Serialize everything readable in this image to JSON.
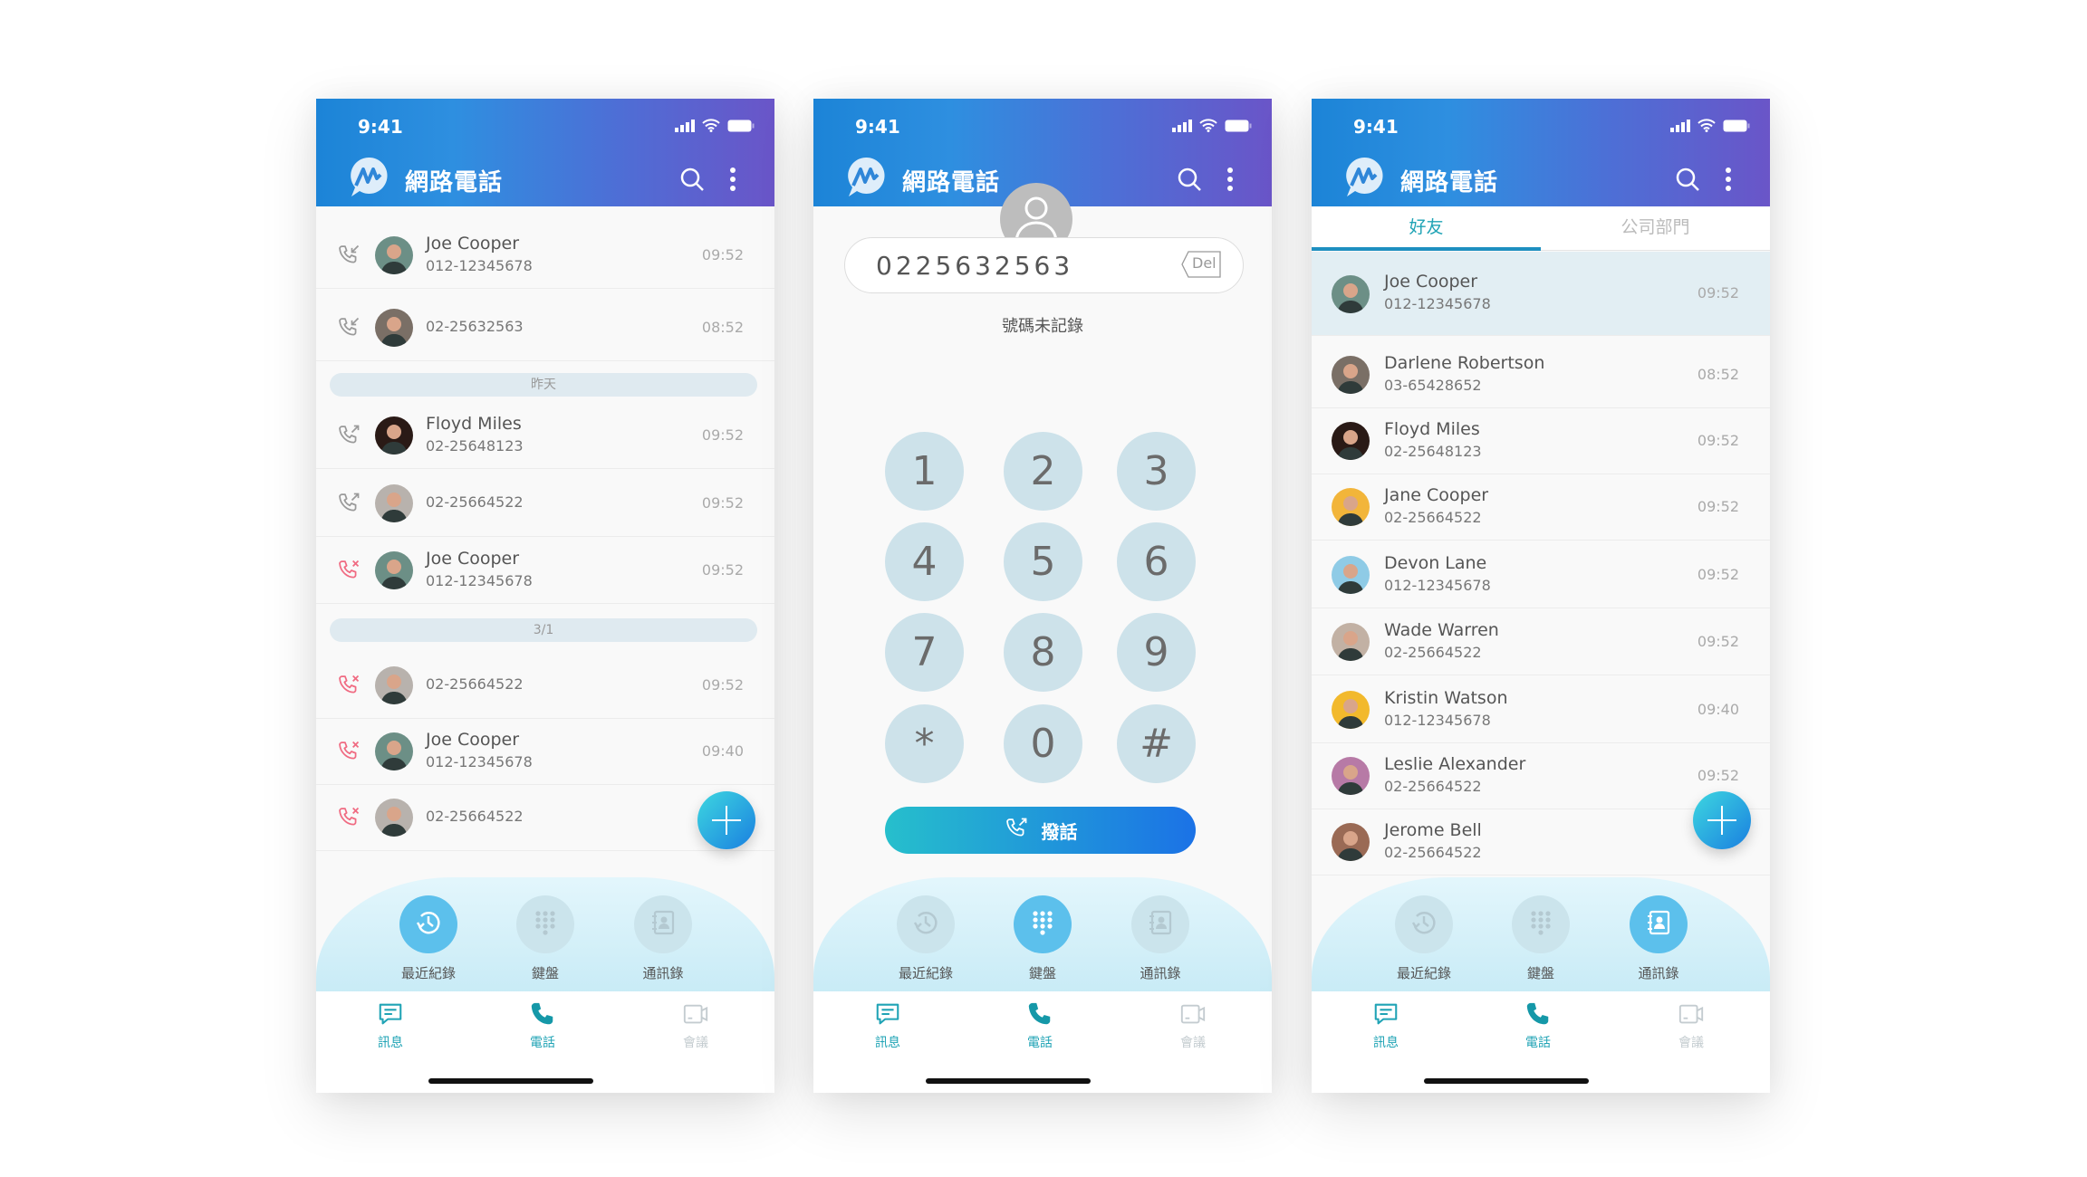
{
  "status_bar": {
    "time": "9:41"
  },
  "app": {
    "title": "網路電話"
  },
  "colors": {
    "missed": "#f06b82",
    "accent": "#1fa3b5",
    "header_start": "#1c84d7",
    "header_end": "#6a55c8"
  },
  "recents": {
    "entries": [
      {
        "type": "incoming",
        "name": "Joe Cooper",
        "number": "012-12345678",
        "time": "09:52",
        "avatar": "#6c8f86"
      },
      {
        "type": "incoming",
        "name": "",
        "number": "02-25632563",
        "time": "08:52",
        "avatar": "#7a6f66"
      },
      {
        "type": "divider",
        "label": "昨天"
      },
      {
        "type": "outgoing",
        "name": "Floyd Miles",
        "number": "02-25648123",
        "time": "09:52",
        "avatar": "#2a1a16"
      },
      {
        "type": "outgoing",
        "name": "",
        "number": "02-25664522",
        "time": "09:52",
        "avatar": "#b8b2ad"
      },
      {
        "type": "missed",
        "name": "Joe Cooper",
        "number": "012-12345678",
        "time": "09:52",
        "avatar": "#6c8f86"
      },
      {
        "type": "divider",
        "label": "3/1"
      },
      {
        "type": "missed",
        "name": "",
        "number": "02-25664522",
        "time": "09:52",
        "avatar": "#b8b2ad"
      },
      {
        "type": "missed",
        "name": "Joe Cooper",
        "number": "012-12345678",
        "time": "09:40",
        "avatar": "#6c8f86"
      },
      {
        "type": "missed",
        "name": "",
        "number": "02-25664522",
        "time": "",
        "avatar": "#b8b2ad"
      }
    ]
  },
  "dialer": {
    "unknown_label": "號碼未記錄",
    "input_value": "0225632563",
    "del_label": "Del",
    "keys": [
      "1",
      "2",
      "3",
      "4",
      "5",
      "6",
      "7",
      "8",
      "9",
      "*",
      "0",
      "#"
    ],
    "call_label": "撥話"
  },
  "contacts": {
    "tabs": [
      {
        "label": "好友",
        "active": true
      },
      {
        "label": "公司部門",
        "active": false
      }
    ],
    "entries": [
      {
        "name": "Joe Cooper",
        "number": "012-12345678",
        "time": "09:52",
        "avatar": "#6c8f86",
        "selected": true
      },
      {
        "name": "Darlene Robertson",
        "number": "03-65428652",
        "time": "08:52",
        "avatar": "#7a6f66"
      },
      {
        "name": "Floyd Miles",
        "number": "02-25648123",
        "time": "09:52",
        "avatar": "#2a1a16"
      },
      {
        "name": "Jane Cooper",
        "number": "02-25664522",
        "time": "09:52",
        "avatar": "#f2b53a"
      },
      {
        "name": "Devon Lane",
        "number": "012-12345678",
        "time": "09:52",
        "avatar": "#8fcbe6"
      },
      {
        "name": "Wade Warren",
        "number": "02-25664522",
        "time": "09:52",
        "avatar": "#c2b1a4"
      },
      {
        "name": "Kristin Watson",
        "number": "012-12345678",
        "time": "09:40",
        "avatar": "#f2b92c"
      },
      {
        "name": "Leslie Alexander",
        "number": "02-25664522",
        "time": "09:52",
        "avatar": "#b77aa6"
      },
      {
        "name": "Jerome Bell",
        "number": "02-25664522",
        "time": "",
        "avatar": "#9a6a55"
      }
    ]
  },
  "dock": {
    "items": [
      {
        "label": "最近紀錄",
        "icon": "history-icon"
      },
      {
        "label": "鍵盤",
        "icon": "keypad-icon"
      },
      {
        "label": "通訊錄",
        "icon": "address-book-icon"
      }
    ]
  },
  "nav": {
    "items": [
      {
        "label": "訊息",
        "icon": "message-icon"
      },
      {
        "label": "電話",
        "icon": "phone-icon"
      },
      {
        "label": "會議",
        "icon": "video-icon"
      }
    ]
  },
  "screens": [
    {
      "active_dock": 0
    },
    {
      "active_dock": 1
    },
    {
      "active_dock": 2
    }
  ]
}
